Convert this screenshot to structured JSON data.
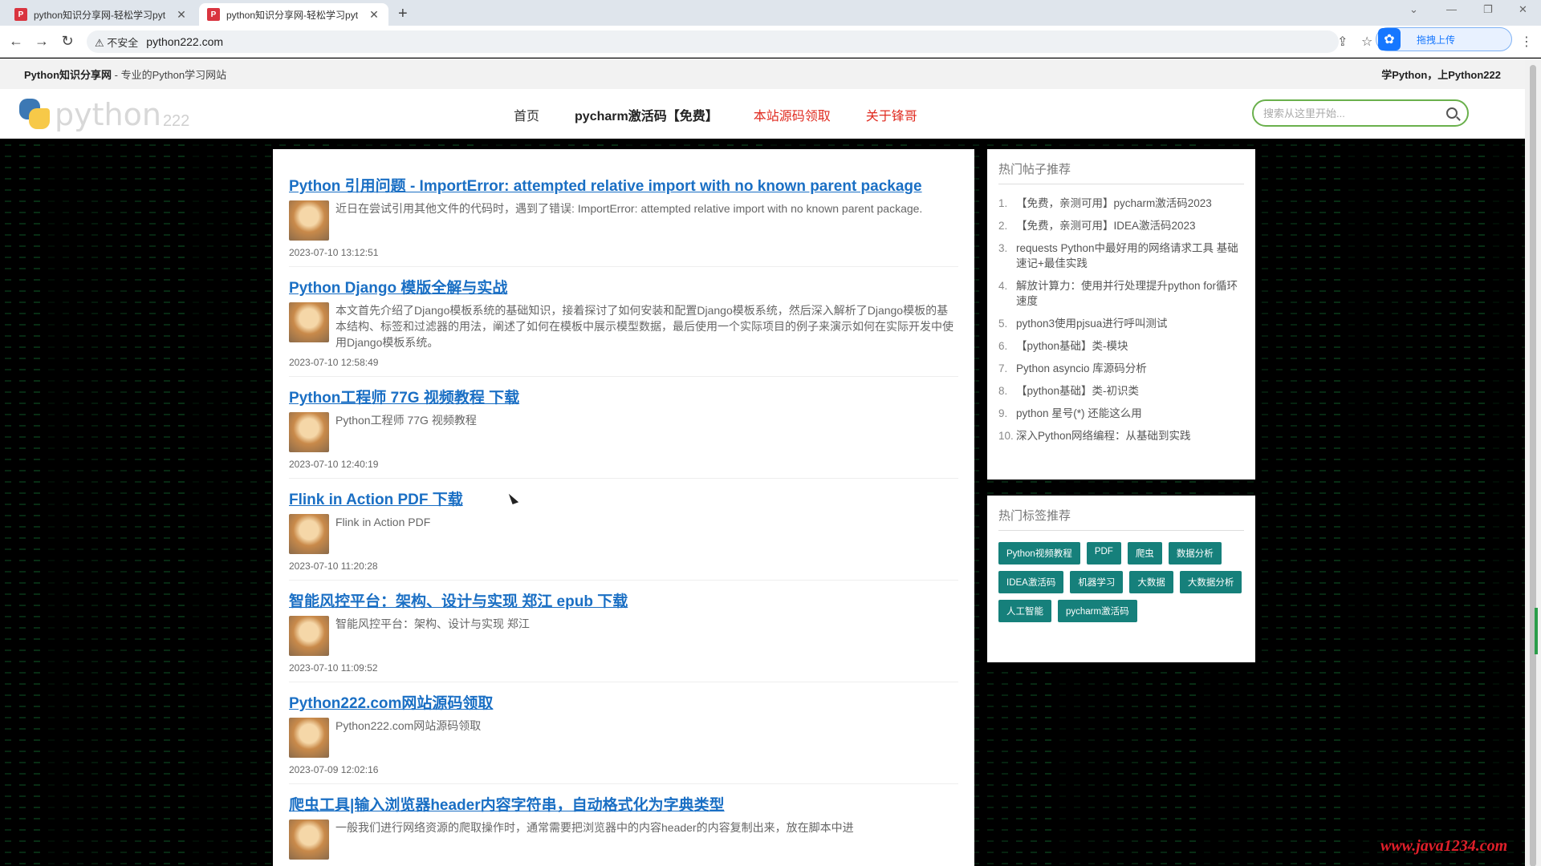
{
  "browser": {
    "tabs": [
      {
        "title": "python知识分享网-轻松学习pyt",
        "active": false
      },
      {
        "title": "python知识分享网-轻松学习pyt",
        "active": true
      }
    ],
    "insecure_label": "不安全",
    "url": "python222.com",
    "extension_label": "拖拽上传"
  },
  "site": {
    "brand_bold": "Python知识分享网",
    "brand_sub": " - 专业的Python学习网站",
    "top_right": "学Python，上Python222",
    "logo_text": "python",
    "logo_num": "222",
    "nav": {
      "home": "首页",
      "pycharm": "pycharm激活码【免费】",
      "source": "本站源码领取",
      "about": "关于锋哥"
    },
    "search_placeholder": "搜索从这里开始..."
  },
  "posts": [
    {
      "title": "Python 引用问题 - ImportError: attempted relative import with no known parent package",
      "excerpt": "近日在尝试引用其他文件的代码时，遇到了错误: ImportError: attempted relative import with no known parent package.",
      "date": "2023-07-10 13:12:51"
    },
    {
      "title": "Python Django 模版全解与实战",
      "excerpt": "本文首先介绍了Django模板系统的基础知识，接着探讨了如何安装和配置Django模板系统，然后深入解析了Django模板的基本结构、标签和过滤器的用法，阐述了如何在模板中展示模型数据，最后使用一个实际项目的例子来演示如何在实际开发中使用Django模板系统。",
      "date": "2023-07-10 12:58:49"
    },
    {
      "title": "Python工程师 77G 视频教程 下载",
      "excerpt": "Python工程师 77G 视频教程",
      "date": "2023-07-10 12:40:19"
    },
    {
      "title": "Flink in Action PDF 下载",
      "excerpt": "Flink in Action PDF",
      "date": "2023-07-10 11:20:28"
    },
    {
      "title": "智能风控平台：架构、设计与实现 郑江 epub 下载",
      "excerpt": "智能风控平台：架构、设计与实现 郑江",
      "date": "2023-07-10 11:09:52"
    },
    {
      "title": "Python222.com网站源码领取",
      "excerpt": "Python222.com网站源码领取",
      "date": "2023-07-09 12:02:16"
    },
    {
      "title": "爬虫工具|输入浏览器header内容字符串，自动格式化为字典类型",
      "excerpt": "一般我们进行网络资源的爬取操作时，通常需要把浏览器中的内容header的内容复制出来，放在脚本中进",
      "date": ""
    }
  ],
  "sidebar": {
    "hot_posts_title": "热门帖子推荐",
    "hot_posts": [
      {
        "num": "1.",
        "text": "【免费，亲测可用】pycharm激活码2023"
      },
      {
        "num": "2.",
        "text": "【免费，亲测可用】IDEA激活码2023"
      },
      {
        "num": "3.",
        "text": "requests Python中最好用的网络请求工具 基础速记+最佳实践"
      },
      {
        "num": "4.",
        "text": "解放计算力：使用并行处理提升python for循环速度"
      },
      {
        "num": "5.",
        "text": "python3使用pjsua进行呼叫测试"
      },
      {
        "num": "6.",
        "text": "【python基础】类-模块"
      },
      {
        "num": "7.",
        "text": "Python asyncio 库源码分析"
      },
      {
        "num": "8.",
        "text": "【python基础】类-初识类"
      },
      {
        "num": "9.",
        "text": "python 星号(*) 还能这么用"
      },
      {
        "num": "10.",
        "text": "深入Python网络编程：从基础到实践"
      }
    ],
    "hot_tags_title": "热门标签推荐",
    "tags": [
      "Python视频教程",
      "PDF",
      "爬虫",
      "数据分析",
      "IDEA激活码",
      "机器学习",
      "大数据",
      "大数据分析",
      "人工智能",
      "pycharm激活码"
    ]
  },
  "watermark": "www.java1234.com"
}
